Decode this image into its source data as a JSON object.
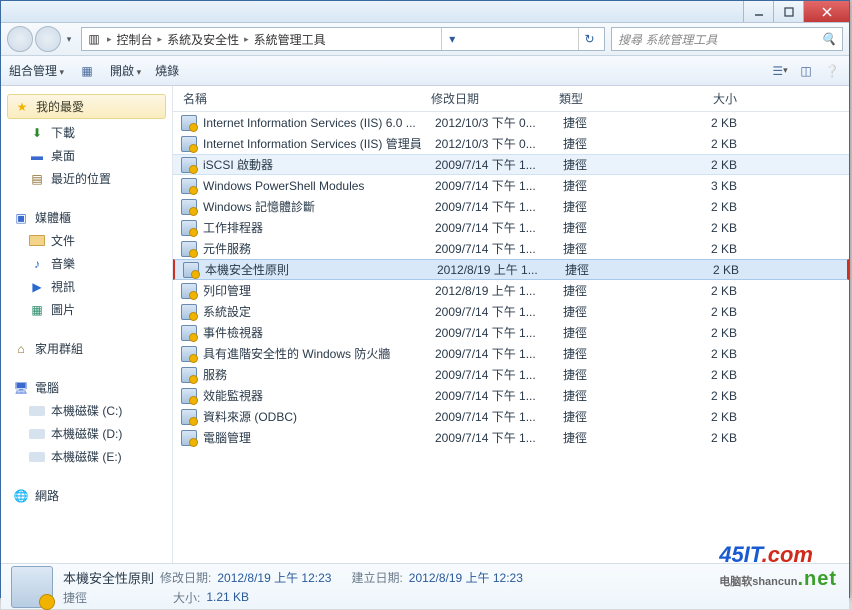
{
  "breadcrumb": [
    "控制台",
    "系統及安全性",
    "系統管理工具"
  ],
  "search_placeholder": "搜尋 系統管理工具",
  "toolbar": {
    "organize": "組合管理",
    "open": "開啟",
    "burn": "燒錄"
  },
  "sidebar": {
    "fav_header": "我的最愛",
    "fav": [
      "下載",
      "桌面",
      "最近的位置"
    ],
    "lib_header": "媒體櫃",
    "lib": [
      "文件",
      "音樂",
      "視訊",
      "圖片"
    ],
    "home_header": "家用群組",
    "pc_header": "電腦",
    "pc": [
      "本機磁碟 (C:)",
      "本機磁碟 (D:)",
      "本機磁碟 (E:)"
    ],
    "net_header": "網路"
  },
  "columns": {
    "name": "名稱",
    "date": "修改日期",
    "type": "類型",
    "size": "大小"
  },
  "rows": [
    {
      "name": "Internet Information Services (IIS) 6.0 ...",
      "date": "2012/10/3 下午 0...",
      "type": "捷徑",
      "size": "2 KB"
    },
    {
      "name": "Internet Information Services (IIS) 管理員",
      "date": "2012/10/3 下午 0...",
      "type": "捷徑",
      "size": "2 KB"
    },
    {
      "name": "iSCSI 啟動器",
      "date": "2009/7/14 下午 1...",
      "type": "捷徑",
      "size": "2 KB",
      "hov": true
    },
    {
      "name": "Windows PowerShell Modules",
      "date": "2009/7/14 下午 1...",
      "type": "捷徑",
      "size": "3 KB"
    },
    {
      "name": "Windows 記憶體診斷",
      "date": "2009/7/14 下午 1...",
      "type": "捷徑",
      "size": "2 KB"
    },
    {
      "name": "工作排程器",
      "date": "2009/7/14 下午 1...",
      "type": "捷徑",
      "size": "2 KB"
    },
    {
      "name": "元件服務",
      "date": "2009/7/14 下午 1...",
      "type": "捷徑",
      "size": "2 KB"
    },
    {
      "name": "本機安全性原則",
      "date": "2012/8/19 上午 1...",
      "type": "捷徑",
      "size": "2 KB",
      "sel": true,
      "red": true
    },
    {
      "name": "列印管理",
      "date": "2012/8/19 上午 1...",
      "type": "捷徑",
      "size": "2 KB"
    },
    {
      "name": "系統設定",
      "date": "2009/7/14 下午 1...",
      "type": "捷徑",
      "size": "2 KB"
    },
    {
      "name": "事件檢視器",
      "date": "2009/7/14 下午 1...",
      "type": "捷徑",
      "size": "2 KB"
    },
    {
      "name": "具有進階安全性的 Windows 防火牆",
      "date": "2009/7/14 下午 1...",
      "type": "捷徑",
      "size": "2 KB"
    },
    {
      "name": "服務",
      "date": "2009/7/14 下午 1...",
      "type": "捷徑",
      "size": "2 KB"
    },
    {
      "name": "效能監視器",
      "date": "2009/7/14 下午 1...",
      "type": "捷徑",
      "size": "2 KB"
    },
    {
      "name": "資料來源 (ODBC)",
      "date": "2009/7/14 下午 1...",
      "type": "捷徑",
      "size": "2 KB"
    },
    {
      "name": "電腦管理",
      "date": "2009/7/14 下午 1...",
      "type": "捷徑",
      "size": "2 KB"
    }
  ],
  "details": {
    "title": "本機安全性原則",
    "type": "捷徑",
    "mod_label": "修改日期:",
    "mod_value": "2012/8/19 上午 12:23",
    "create_label": "建立日期:",
    "create_value": "2012/8/19 上午 12:23",
    "size_label": "大小:",
    "size_value": "1.21 KB"
  },
  "logo": {
    "brand": "45IT",
    "suffix": ".com",
    "line2": "电脑软shancun",
    "line3": ".net"
  }
}
